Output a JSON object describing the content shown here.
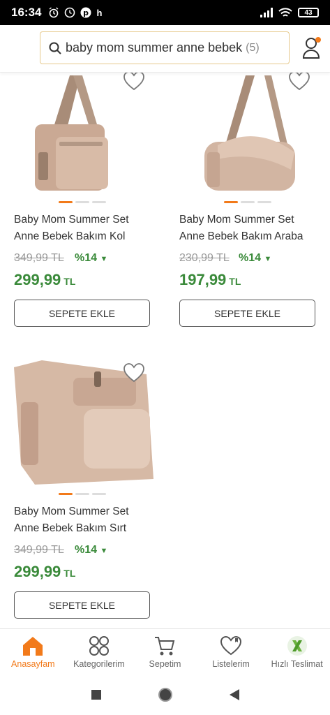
{
  "status": {
    "time": "16:34",
    "battery": "43"
  },
  "search": {
    "query": "baby mom summer anne bebek",
    "count": "(5)"
  },
  "products": [
    {
      "name_line1": "Baby Mom Summer Set",
      "name_line2": "Anne Bebek Bakım Kol",
      "old_price": "349,99 TL",
      "discount": "%14",
      "price": "299,99",
      "currency": "TL",
      "button": "SEPETE EKLE"
    },
    {
      "name_line1": "Baby Mom Summer Set",
      "name_line2": "Anne Bebek Bakım Araba",
      "old_price": "230,99 TL",
      "discount": "%14",
      "price": "197,99",
      "currency": "TL",
      "button": "SEPETE EKLE"
    },
    {
      "name_line1": "Baby Mom Summer Set",
      "name_line2": "Anne Bebek Bakım Sırt",
      "old_price": "349,99 TL",
      "discount": "%14",
      "price": "299,99",
      "currency": "TL",
      "button": "SEPETE EKLE"
    }
  ],
  "tabs": [
    {
      "label": "Anasayfam",
      "icon": "home-icon",
      "active": true
    },
    {
      "label": "Kategorilerim",
      "icon": "categories-icon"
    },
    {
      "label": "Sepetim",
      "icon": "cart-icon"
    },
    {
      "label": "Listelerim",
      "icon": "heart-list-icon"
    },
    {
      "label": "Hızlı Teslimat",
      "icon": "fast-delivery-icon"
    }
  ],
  "colors": {
    "accent": "#f27a1a",
    "price_green": "#3a8a3a",
    "search_border": "#e6c98c"
  }
}
